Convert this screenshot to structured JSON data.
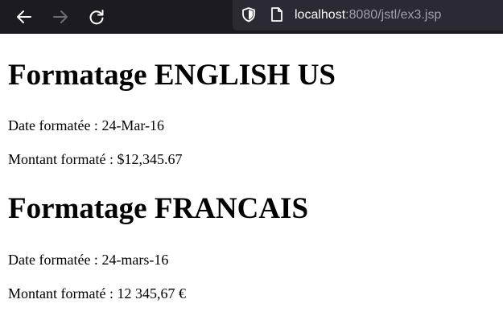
{
  "browser": {
    "url_host": "localhost",
    "url_rest": ":8080/jstl/ex3.jsp",
    "colors": {
      "toolbar_bg": "#1c1b22",
      "urlbar_bg": "#2b2a33",
      "icon_active": "#fbfbfe",
      "icon_disabled": "#6e6d75"
    },
    "icons": [
      "back-arrow-icon",
      "forward-arrow-icon",
      "reload-icon",
      "shield-icon",
      "page-icon"
    ]
  },
  "sections": [
    {
      "heading": "Formatage ENGLISH US",
      "date_line": "Date formatée : 24-Mar-16",
      "amount_line": "Montant formaté : $12,345.67"
    },
    {
      "heading": "Formatage FRANCAIS",
      "date_line": "Date formatée : 24-mars-16",
      "amount_line": "Montant formaté : 12 345,67 €"
    }
  ]
}
